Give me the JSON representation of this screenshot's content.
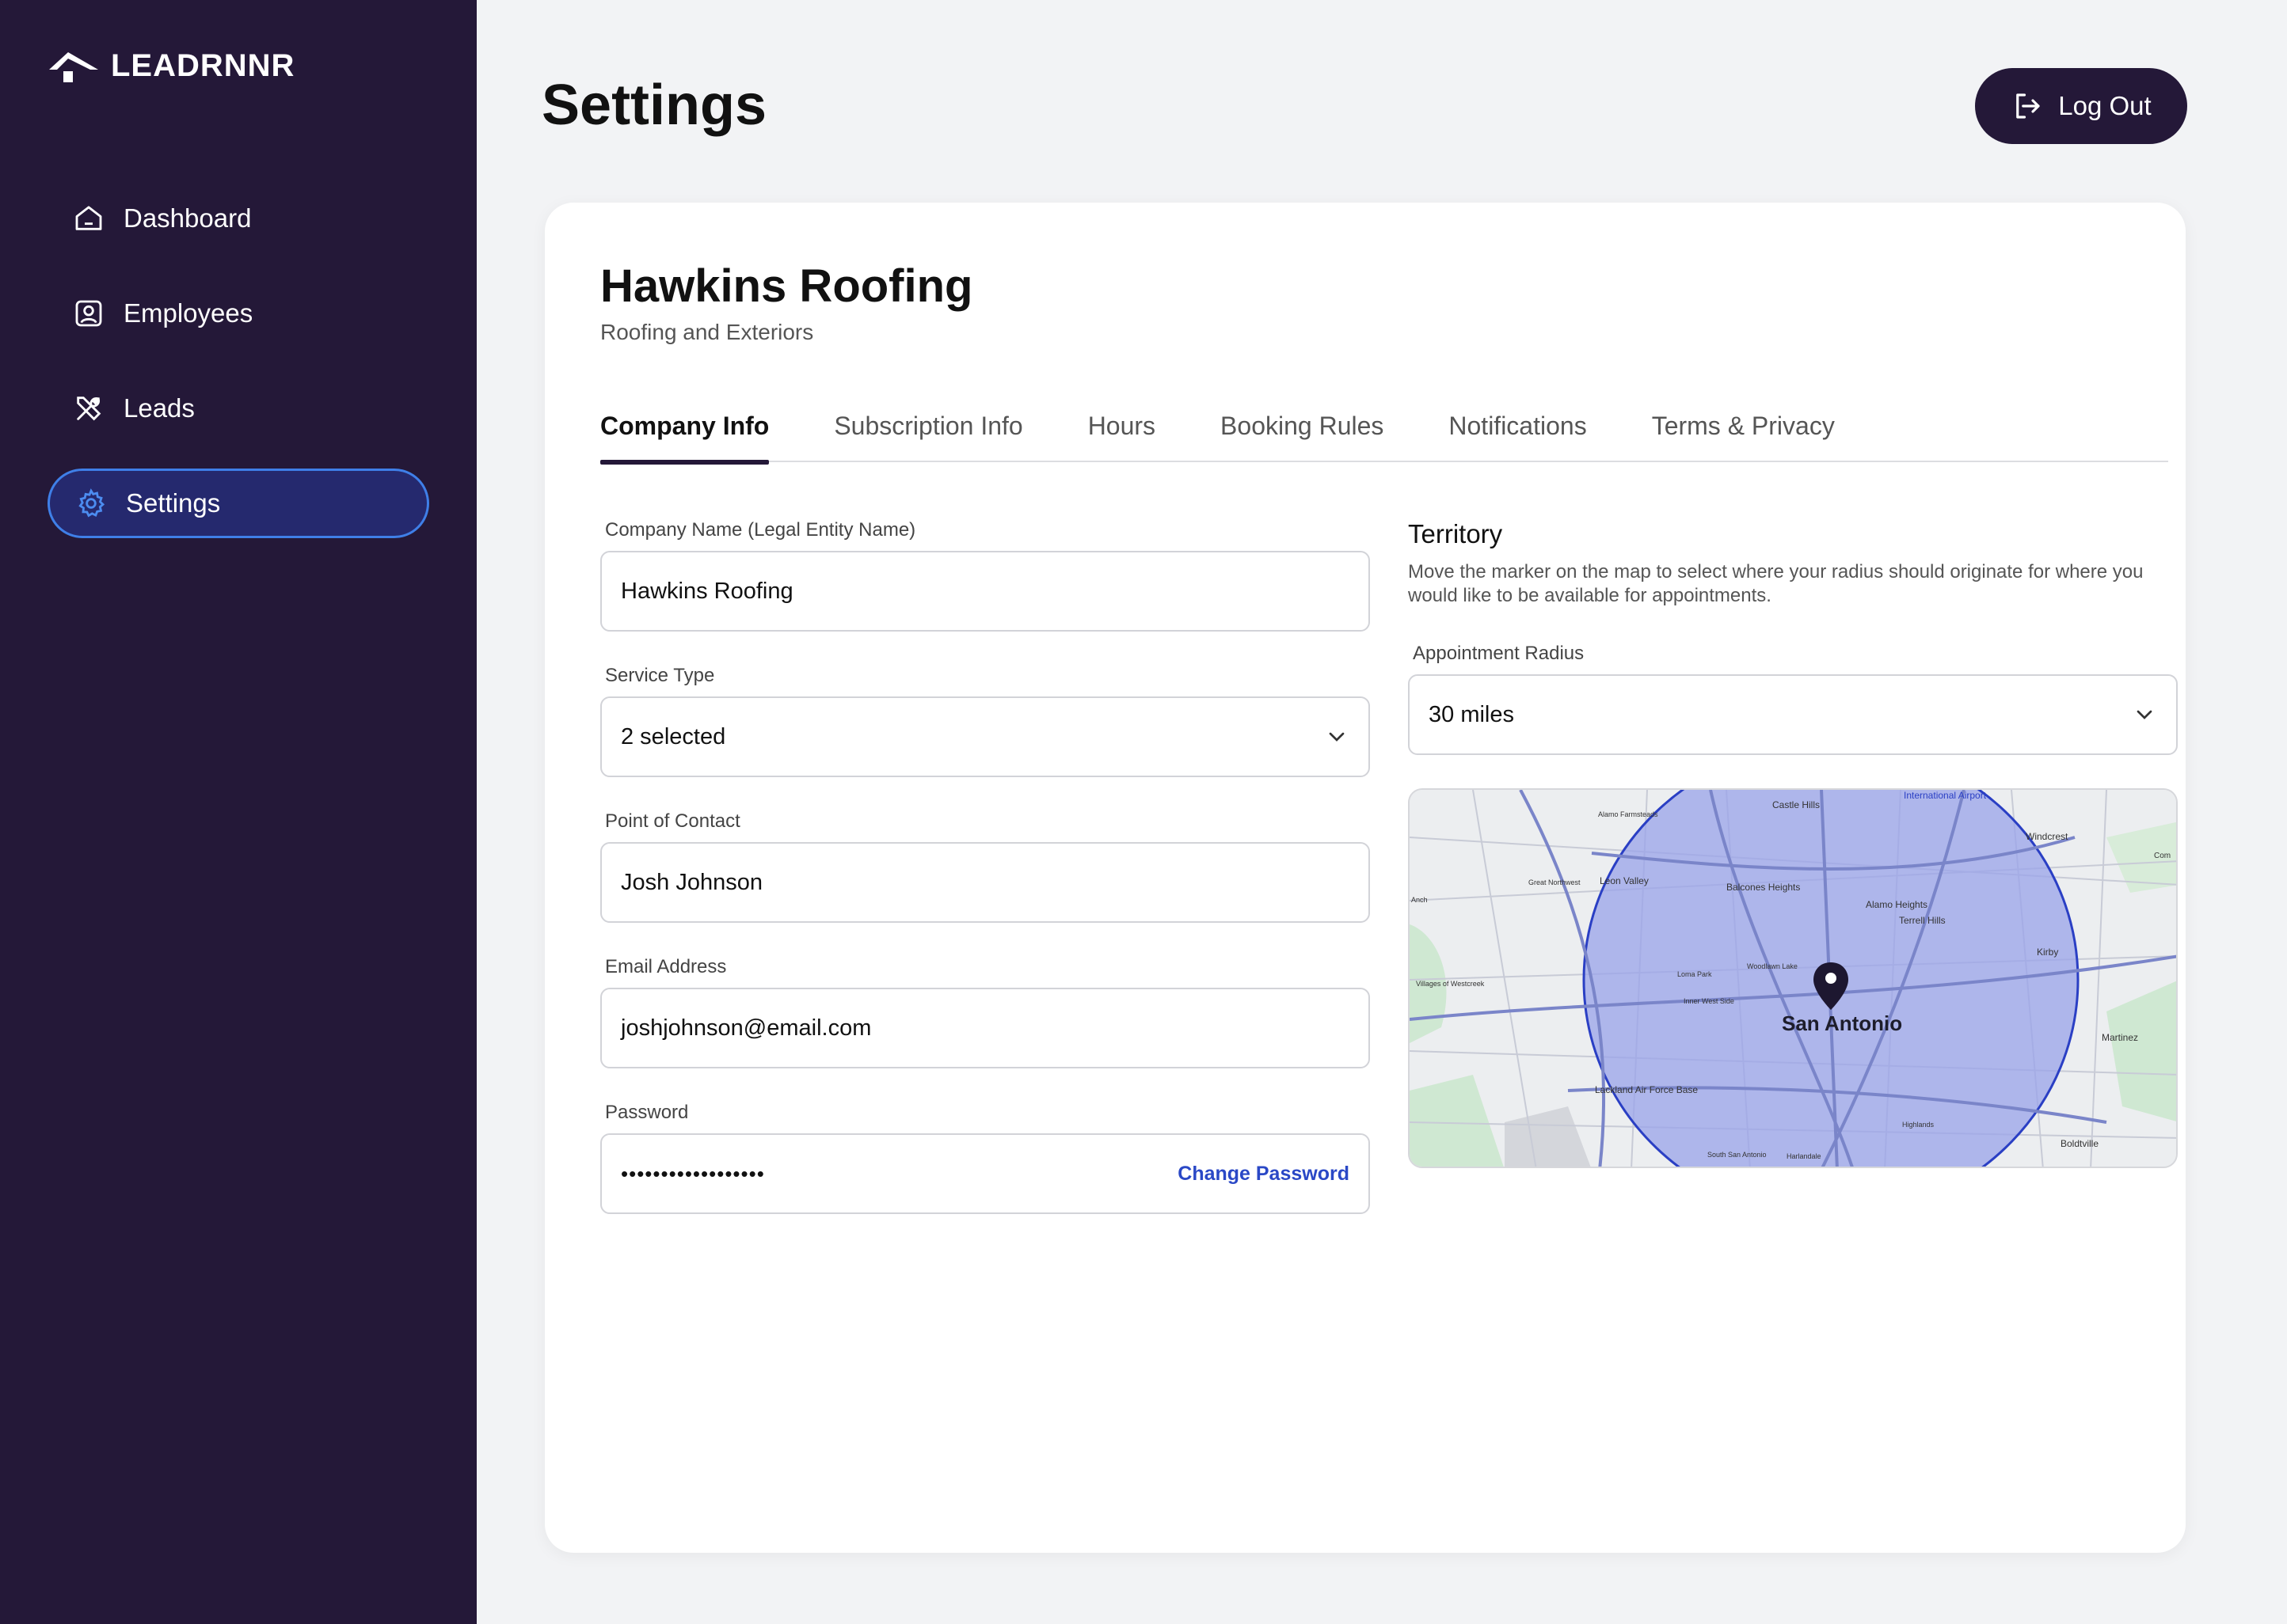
{
  "brand": {
    "name": "LEADRNNR"
  },
  "sidebar": {
    "items": [
      {
        "label": "Dashboard",
        "icon": "home-icon",
        "active": false
      },
      {
        "label": "Employees",
        "icon": "user-badge-icon",
        "active": false
      },
      {
        "label": "Leads",
        "icon": "tools-icon",
        "active": false
      },
      {
        "label": "Settings",
        "icon": "gear-icon",
        "active": true
      }
    ]
  },
  "header": {
    "title": "Settings",
    "logout_label": "Log Out"
  },
  "company": {
    "name": "Hawkins Roofing",
    "subtitle": "Roofing and Exteriors"
  },
  "tabs": [
    {
      "label": "Company Info",
      "active": true
    },
    {
      "label": "Subscription Info",
      "active": false
    },
    {
      "label": "Hours",
      "active": false
    },
    {
      "label": "Booking Rules",
      "active": false
    },
    {
      "label": "Notifications",
      "active": false
    },
    {
      "label": "Terms & Privacy",
      "active": false
    }
  ],
  "form": {
    "company_name_label": "Company Name (Legal Entity Name)",
    "company_name_value": "Hawkins Roofing",
    "service_type_label": "Service Type",
    "service_type_value": "2 selected",
    "contact_label": "Point of Contact",
    "contact_value": "Josh Johnson",
    "email_label": "Email Address",
    "email_value": "joshjohnson@email.com",
    "password_label": "Password",
    "password_value": "••••••••••••••••••",
    "change_password_label": "Change Password"
  },
  "territory": {
    "title": "Territory",
    "description": "Move the marker on the map to select where your radius should originate for where you would like to be available for appointments.",
    "radius_label": "Appointment Radius",
    "radius_value": "30 miles",
    "map": {
      "city": "San Antonio",
      "labels": [
        "Castle Hills",
        "International Airport",
        "Alamo Farmsteads",
        "Leon Valley",
        "Great Northwest",
        "Balcones Heights",
        "Alamo Heights",
        "Terrell Hills",
        "Windcrest",
        "Kirby",
        "Loma Park",
        "Woodlawn Lake",
        "Inner West Side",
        "Villages of Westcreek",
        "Lackland Air Force Base",
        "Highlands",
        "South San Antonio",
        "Harlandale",
        "Martinez",
        "Boldtville",
        "Anch",
        "Com"
      ],
      "colors": {
        "radius_fill": "#9aa3ea",
        "radius_stroke": "#2a3fc4",
        "marker": "#1d1730"
      }
    }
  }
}
